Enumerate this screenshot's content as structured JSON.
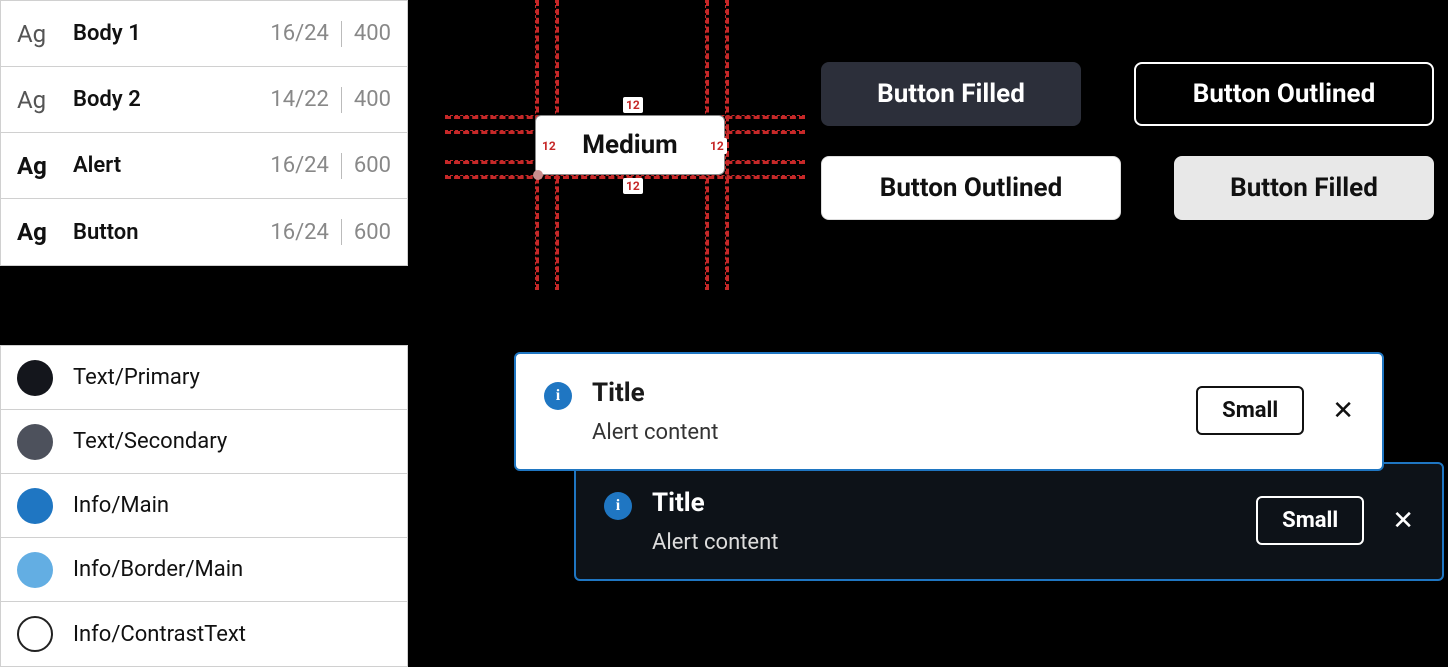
{
  "typography": [
    {
      "sample": "Ag",
      "bold": false,
      "name": "Body 1",
      "size": "16/24",
      "weight": "400"
    },
    {
      "sample": "Ag",
      "bold": false,
      "name": "Body 2",
      "size": "14/22",
      "weight": "400"
    },
    {
      "sample": "Ag",
      "bold": true,
      "name": "Alert",
      "size": "16/24",
      "weight": "600"
    },
    {
      "sample": "Ag",
      "bold": true,
      "name": "Button",
      "size": "16/24",
      "weight": "600"
    }
  ],
  "colors": [
    {
      "label": "Text/Primary",
      "hex": "#14161c"
    },
    {
      "label": "Text/Secondary",
      "hex": "#4d515c"
    },
    {
      "label": "Info/Main",
      "hex": "#1f76c2"
    },
    {
      "label": "Info/Border/Main",
      "hex": "#63aee3"
    },
    {
      "label": "Info/ContrastText",
      "hex": "outline"
    }
  ],
  "spec": {
    "label": "Medium",
    "padding_top": "12",
    "padding_right": "12",
    "padding_bottom": "12",
    "padding_left": "12"
  },
  "buttons": {
    "filled_dark": "Button Filled",
    "outlined_dark": "Button Outlined",
    "outlined_light": "Button Outlined",
    "filled_light": "Button Filled"
  },
  "alerts": {
    "light": {
      "title": "Title",
      "content": "Alert content",
      "action": "Small"
    },
    "dark": {
      "title": "Title",
      "content": "Alert content",
      "action": "Small"
    }
  }
}
